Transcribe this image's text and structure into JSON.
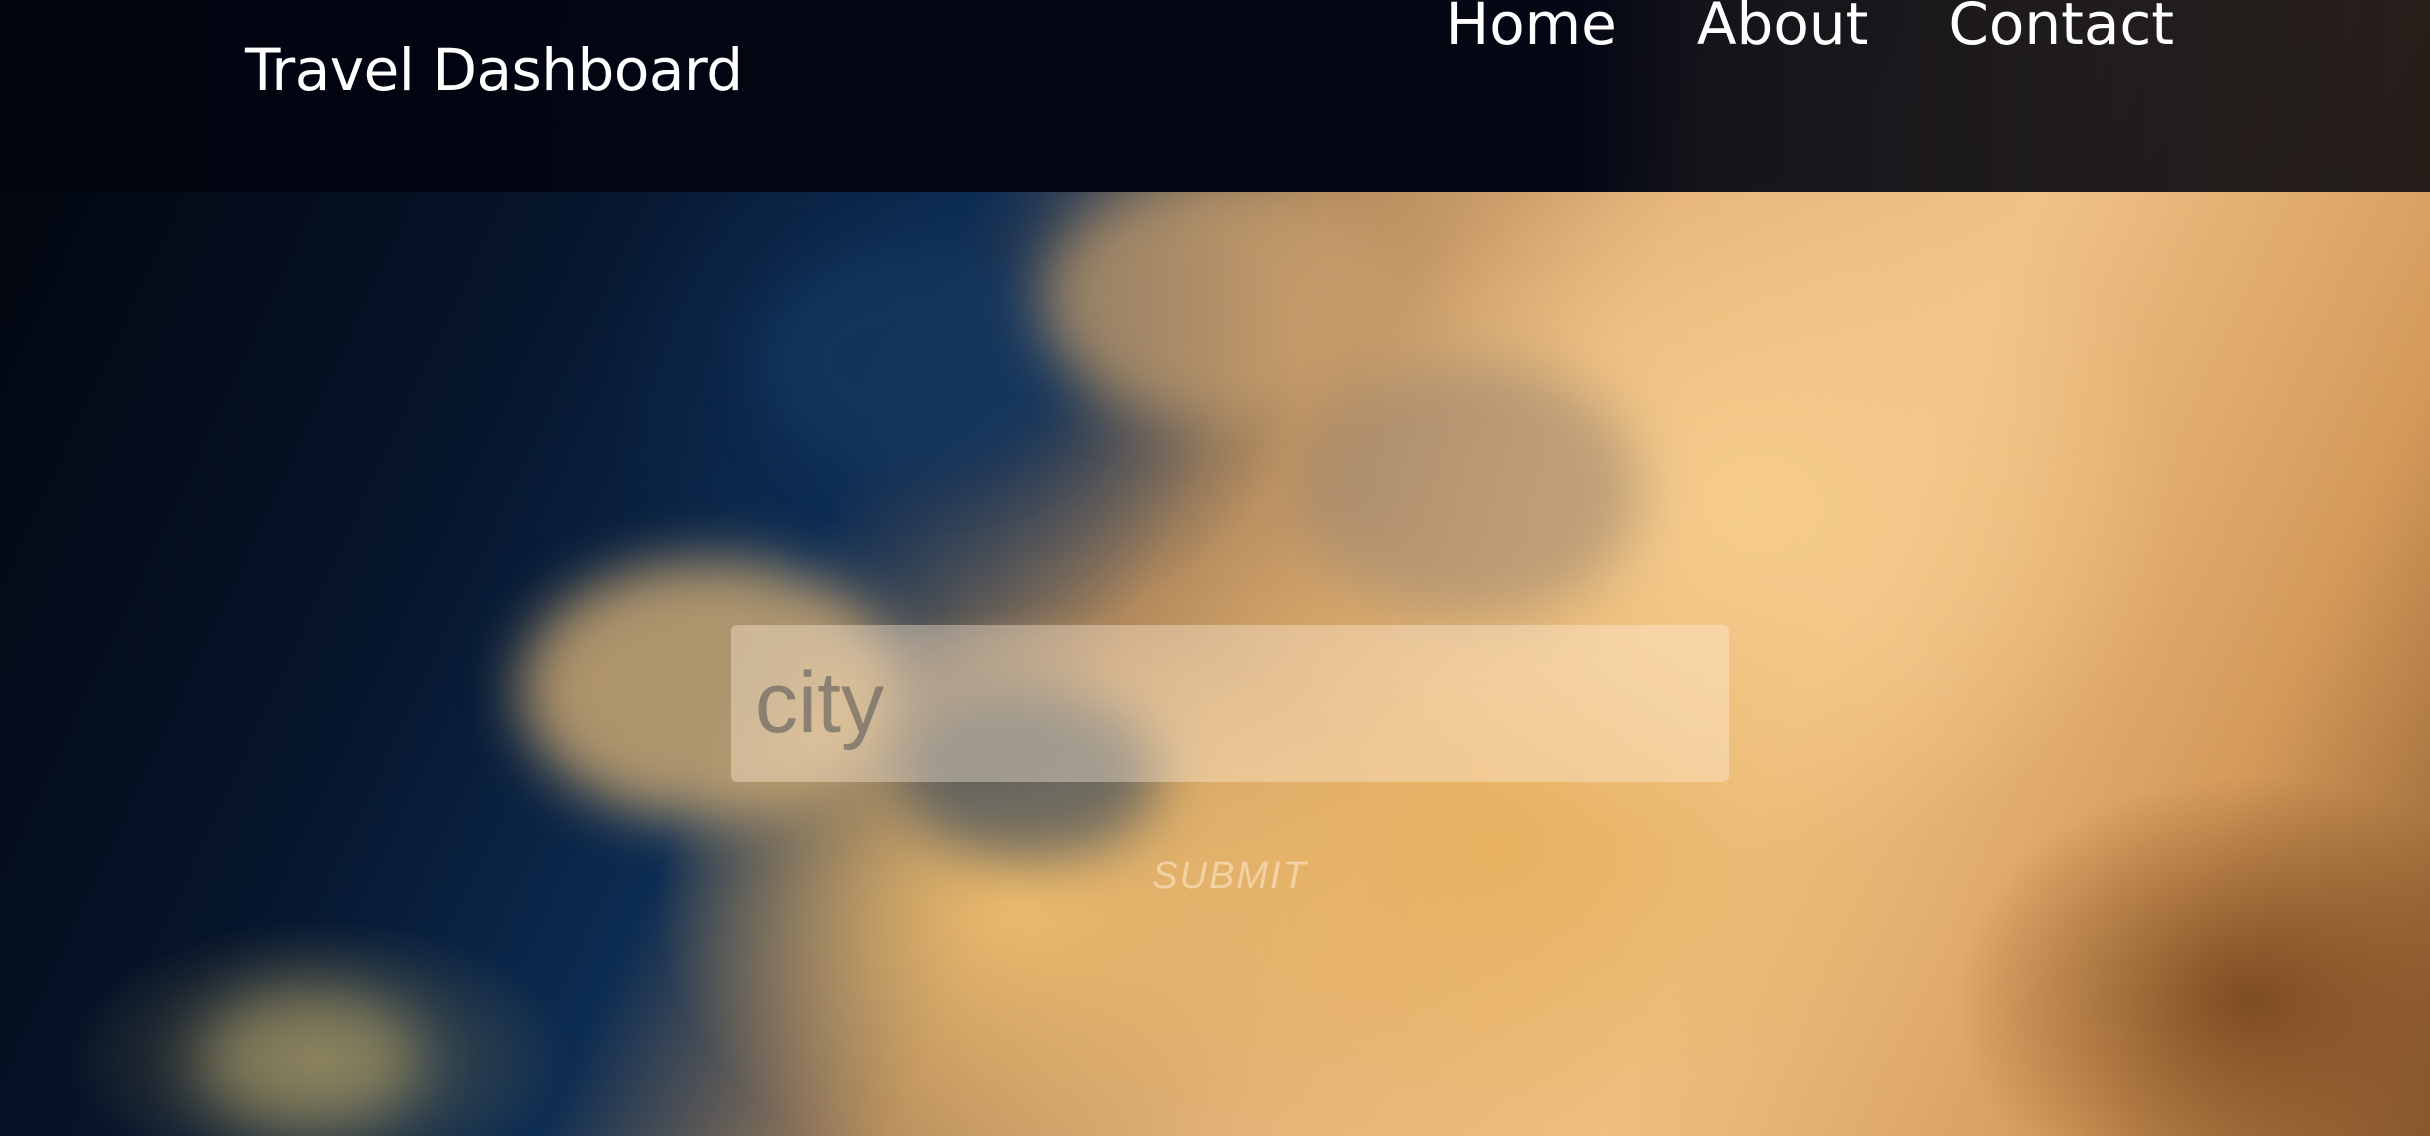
{
  "header": {
    "brand": "Travel Dashboard",
    "nav": [
      {
        "label": "Home"
      },
      {
        "label": "About"
      },
      {
        "label": "Contact"
      }
    ]
  },
  "search": {
    "placeholder": "city",
    "value": "",
    "submit_label": "SUBMIT"
  },
  "colors": {
    "navbar_bg": "#020510",
    "text": "#ffffff",
    "sky_dark": "#06142a",
    "sky_warm": "#f0c287"
  }
}
